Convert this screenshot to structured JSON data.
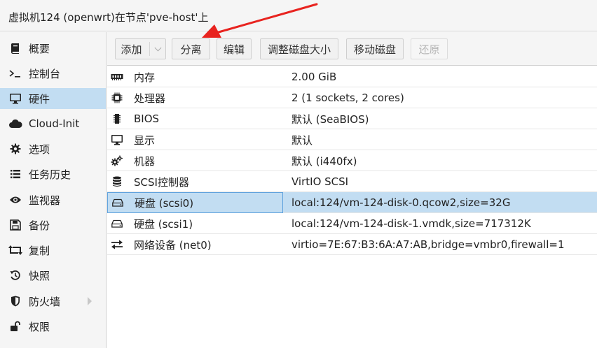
{
  "window": {
    "title": "虚拟机124 (openwrt)在节点'pve-host'上"
  },
  "sidebar": {
    "items": [
      {
        "label": "概要",
        "icon": "book-icon"
      },
      {
        "label": "控制台",
        "icon": "terminal-icon"
      },
      {
        "label": "硬件",
        "icon": "monitor-icon",
        "active": true
      },
      {
        "label": "Cloud-Init",
        "icon": "cloud-icon"
      },
      {
        "label": "选项",
        "icon": "gear-icon"
      },
      {
        "label": "任务历史",
        "icon": "list-icon"
      },
      {
        "label": "监视器",
        "icon": "eye-icon"
      },
      {
        "label": "备份",
        "icon": "floppy-icon"
      },
      {
        "label": "复制",
        "icon": "retweet-icon"
      },
      {
        "label": "快照",
        "icon": "history-icon"
      },
      {
        "label": "防火墙",
        "icon": "shield-icon",
        "has_submenu": true
      },
      {
        "label": "权限",
        "icon": "unlock-icon"
      }
    ]
  },
  "toolbar": {
    "add_label": "添加",
    "detach_label": "分离",
    "edit_label": "编辑",
    "resize_label": "调整磁盘大小",
    "move_label": "移动磁盘",
    "revert_label": "还原"
  },
  "hardware": {
    "rows": [
      {
        "icon": "memory-icon",
        "key": "内存",
        "value": "2.00 GiB"
      },
      {
        "icon": "cpu-icon",
        "key": "处理器",
        "value": "2 (1 sockets, 2 cores)"
      },
      {
        "icon": "chip-icon",
        "key": "BIOS",
        "value": "默认 (SeaBIOS)"
      },
      {
        "icon": "desktop-icon",
        "key": "显示",
        "value": "默认"
      },
      {
        "icon": "cogs-icon",
        "key": "机器",
        "value": "默认 (i440fx)"
      },
      {
        "icon": "database-icon",
        "key": "SCSI控制器",
        "value": "VirtIO SCSI"
      },
      {
        "icon": "hdd-icon",
        "key": "硬盘 (scsi0)",
        "value": "local:124/vm-124-disk-0.qcow2,size=32G",
        "selected": true
      },
      {
        "icon": "hdd-icon",
        "key": "硬盘 (scsi1)",
        "value": "local:124/vm-124-disk-1.vmdk,size=717312K"
      },
      {
        "icon": "exchange-icon",
        "key": "网络设备 (net0)",
        "value": "virtio=7E:67:B3:6A:A7:AB,bridge=vmbr0,firewall=1"
      }
    ]
  },
  "colors": {
    "selection": "#c2ddf2",
    "selection_border": "#5fa2dd",
    "annotation_arrow": "#e8231f"
  }
}
